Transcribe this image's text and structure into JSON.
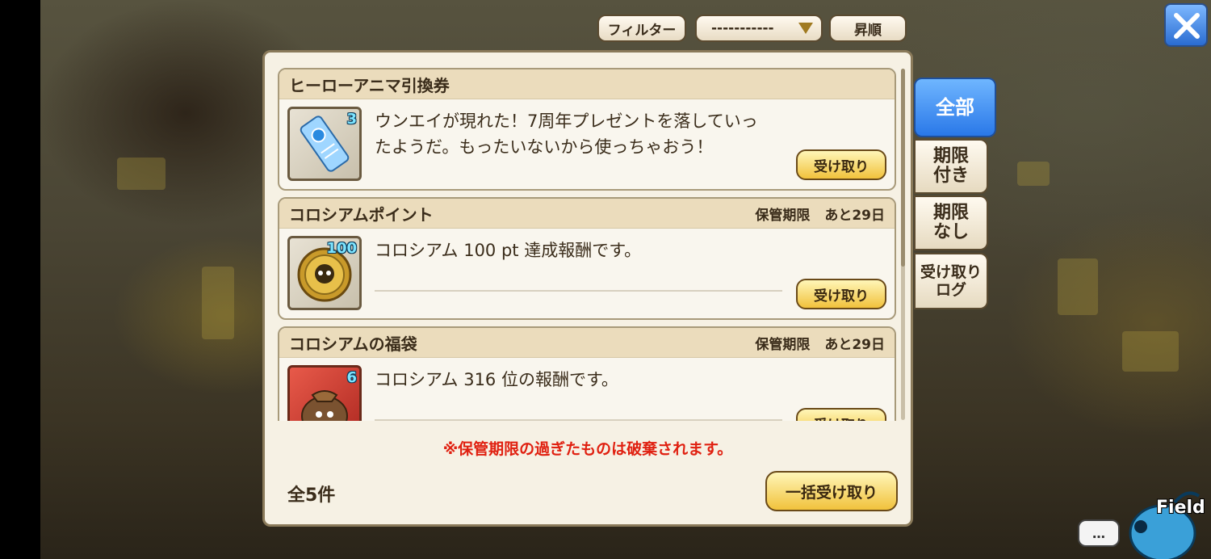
{
  "topbar": {
    "filter_label": "フィルター",
    "dropdown_value": "-----------",
    "sort_label": "昇順"
  },
  "items": [
    {
      "title": "ヒーローアニマ引換券",
      "count": "3",
      "desc_line1": "ウンエイが現れた！7周年プレゼントを落していっ",
      "desc_line2": "たようだ。もったいないから使っちゃおう！",
      "expiry_label": "",
      "expiry_value": "",
      "claim_label": "受け取り",
      "icon": "ticket-icon"
    },
    {
      "title": "コロシアムポイント",
      "count": "100",
      "desc_line1": "コロシアム 100 pt 達成報酬です。",
      "desc_line2": "",
      "expiry_label": "保管期限",
      "expiry_value": "あと29日",
      "claim_label": "受け取り",
      "icon": "coin-icon"
    },
    {
      "title": "コロシアムの福袋",
      "count": "6",
      "desc_line1": "コロシアム 316 位の報酬です。",
      "desc_line2": "",
      "expiry_label": "保管期限",
      "expiry_value": "あと29日",
      "claim_label": "受け取り",
      "icon": "lucky-bag-icon"
    }
  ],
  "footer": {
    "warning": "※保管期限の過ぎたものは破棄されます。",
    "total": "全5件",
    "bulk_claim_label": "一括受け取り"
  },
  "tabs": {
    "all": "全部",
    "limited_1": "期限",
    "limited_2": "付き",
    "unlimited_1": "期限",
    "unlimited_2": "なし",
    "log_1": "受け取り",
    "log_2": "ログ"
  },
  "bottom": {
    "field_label": "Field",
    "chat_glyph": "…"
  },
  "colors": {
    "accent_blue": "#2a78e8",
    "warning_red": "#e02010",
    "gold_button": "#f1c23c",
    "count_cyan": "#7de4ff"
  }
}
